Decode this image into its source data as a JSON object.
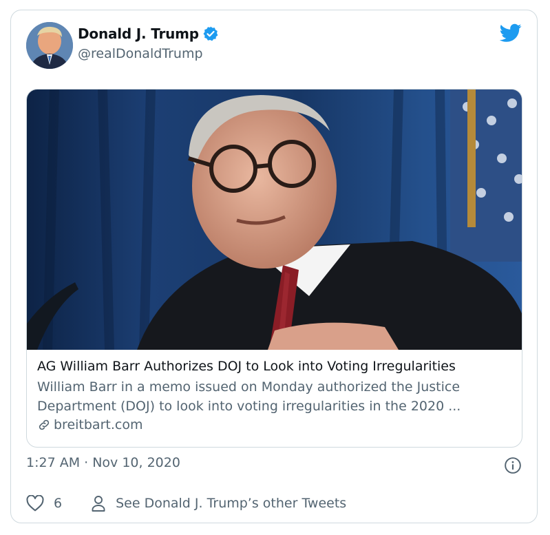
{
  "tweet": {
    "author_name": "Donald J. Trump",
    "author_handle": "@realDonaldTrump",
    "verified": true,
    "timestamp": "1:27 AM · Nov 10, 2020",
    "like_count": "6",
    "other_tweets_label": "See Donald J. Trump’s other Tweets"
  },
  "link_card": {
    "title": "AG William Barr Authorizes DOJ to Look into Voting Irregularities",
    "description": "William Barr in a memo issued on Monday authorized the Justice Department (DOJ) to look into voting irregularities in the 2020 ...",
    "description_line1": "William Barr in a memo issued on Monday authorized the Justice",
    "description_line2": "Department (DOJ) to look into voting irregularities in the 2020 ...",
    "domain": "breitbart.com"
  },
  "icons": {
    "brand": "twitter-bird-icon",
    "verified": "verified-badge-icon",
    "link": "link-icon",
    "info": "info-icon",
    "like": "heart-icon",
    "profile": "person-icon"
  },
  "colors": {
    "twitter_blue": "#1d9bf0",
    "text_primary": "#0f1419",
    "text_secondary": "#536471",
    "border": "#cfd9de"
  }
}
